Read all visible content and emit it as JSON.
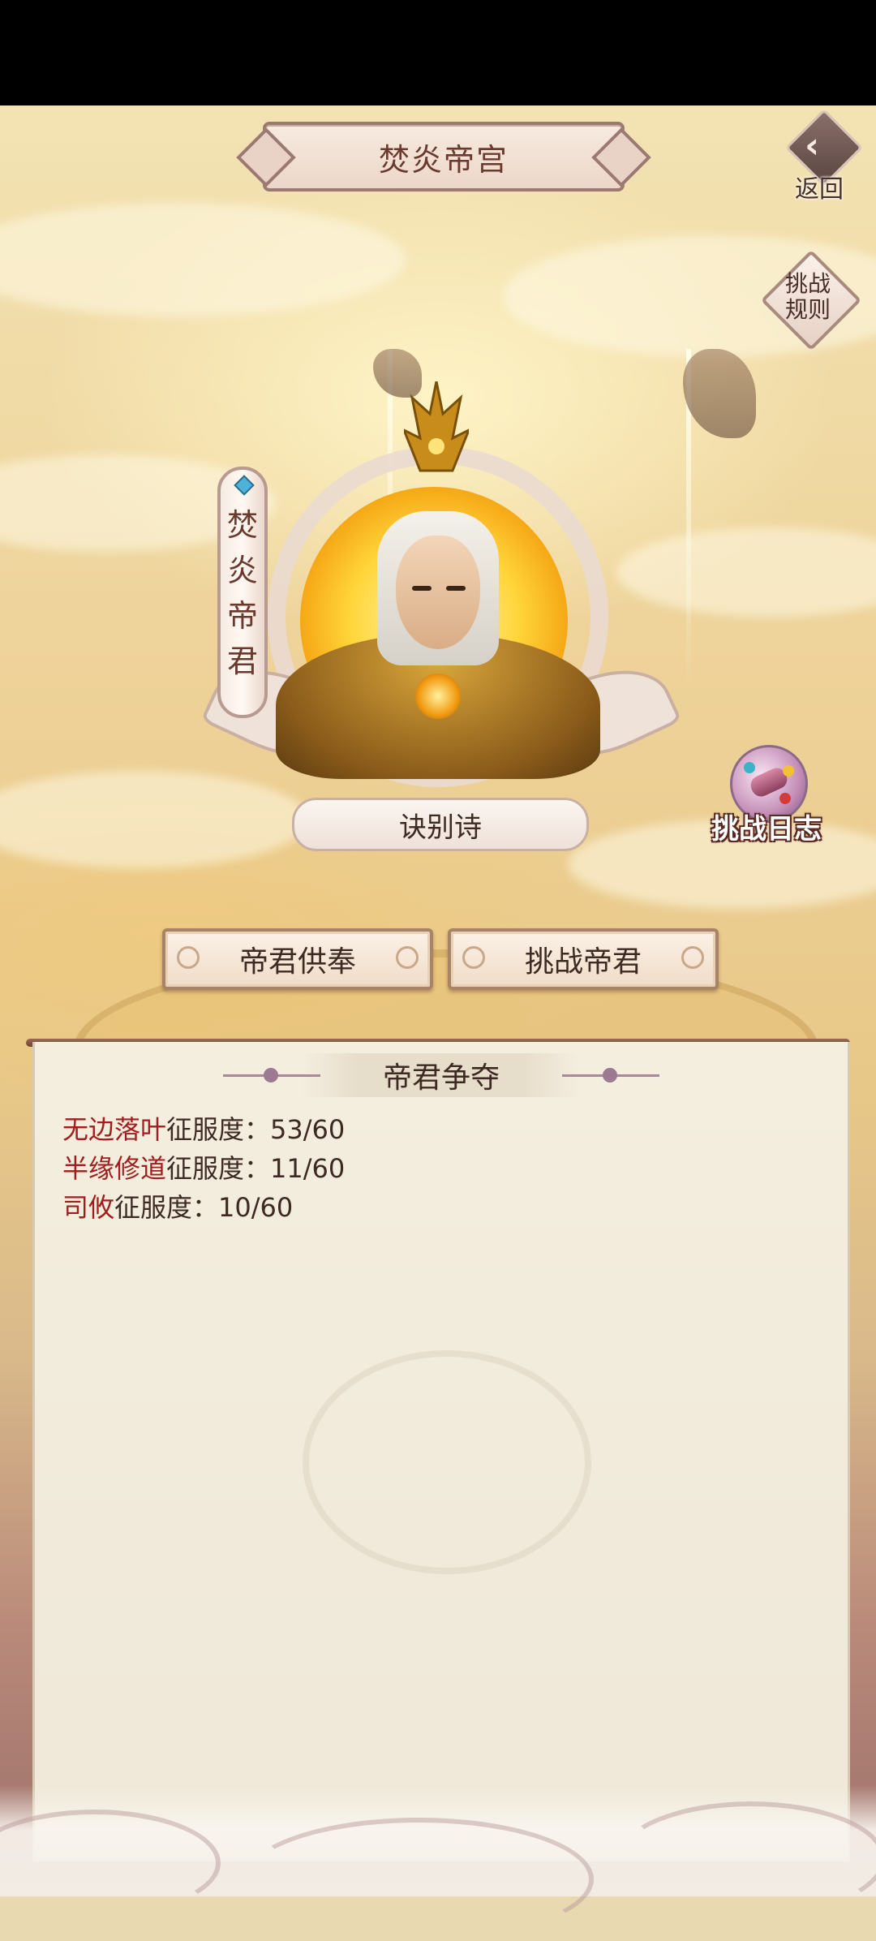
{
  "header": {
    "title": "焚炎帝宫",
    "back_label": "返回",
    "rules_label": "挑战规则"
  },
  "portrait": {
    "name_chars": [
      "焚",
      "炎",
      "帝",
      "君"
    ],
    "caption": "诀别诗"
  },
  "challenge_log": {
    "label": "挑战日志"
  },
  "actions": {
    "tribute": "帝君供奉",
    "challenge": "挑战帝君"
  },
  "panel": {
    "title": "帝君争夺",
    "stats": [
      {
        "name": "无边落叶",
        "label": "征服度：",
        "value": "53/60"
      },
      {
        "name": "半缘修道",
        "label": "征服度：",
        "value": "11/60"
      },
      {
        "name": "司攸",
        "label": "征服度：",
        "value": "10/60"
      }
    ]
  },
  "colors": {
    "highlight_red": "#a01e1e",
    "text_brown": "#3d2a22",
    "gold": "#f4a010"
  },
  "icons": {
    "back": "back-arrow-icon",
    "log": "scroll-icon"
  }
}
